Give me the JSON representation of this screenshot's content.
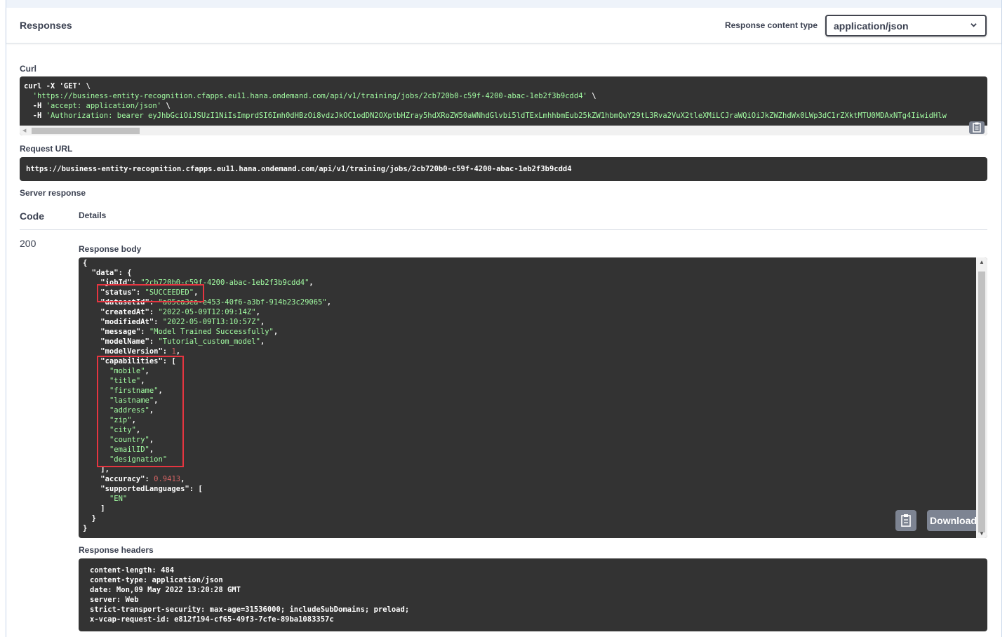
{
  "header": {
    "title": "Responses",
    "content_type_label": "Response content type",
    "content_type_value": "application/json"
  },
  "curl": {
    "label": "Curl",
    "line1": "curl -X 'GET' \\",
    "line2_url": "'https://business-entity-recognition.cfapps.eu11.hana.ondemand.com/api/v1/training/jobs/2cb720b0-c59f-4200-abac-1eb2f3b9cdd4'",
    "line2_tail": " \\",
    "line3_flag": "-H ",
    "line3_val": "'accept: application/json'",
    "line3_tail": " \\",
    "line4_flag": "-H ",
    "line4_val": "'Authorization: bearer eyJhbGciOiJSUzI1NiIsImprdSI6Imh0dHBzOi8vdzJkOC1odDN2OXptbHZray5hdXRoZW50aWNhdGlvbi5ldTExLmhhbmEub25kZW1hbmQuY29tL3Rva2VuX2tleXMiLCJraWQiOiJkZWZhdWx0LWp3dC1rZXktMTU0MDAxNTg4IiwidHlw"
  },
  "request_url": {
    "label": "Request URL",
    "value": "https://business-entity-recognition.cfapps.eu11.hana.ondemand.com/api/v1/training/jobs/2cb720b0-c59f-4200-abac-1eb2f3b9cdd4"
  },
  "server_response": {
    "label": "Server response",
    "col_code": "Code",
    "col_details": "Details",
    "code": "200",
    "body_label": "Response body",
    "download_label": "Download",
    "headers_label": "Response headers"
  },
  "body_json": {
    "jobId": "2cb720b0-c59f-4200-abac-1eb2f3b9cdd4",
    "status": "SUCCEEDED",
    "datasetId": "a05ca3ea-e453-40f6-a3bf-914b23c29065",
    "createdAt": "2022-05-09T12:09:14Z",
    "modifiedAt": "2022-05-09T13:10:57Z",
    "message": "Model Trained Successfully",
    "modelName": "Tutorial_custom_model",
    "modelVersion": "1",
    "capabilities": [
      "mobile",
      "title",
      "firstname",
      "lastname",
      "address",
      "zip",
      "city",
      "country",
      "emailID",
      "designation"
    ],
    "accuracy": "0.9413",
    "supportedLanguages": [
      "EN"
    ]
  },
  "response_headers": [
    "content-length: 484",
    "content-type: application/json",
    "date: Mon,09 May 2022 13:20:28 GMT",
    "server: Web",
    "strict-transport-security: max-age=31536000; includeSubDomains; preload;",
    "x-vcap-request-id: e812f194-cf65-49f3-7cfe-89ba1083357c"
  ],
  "colors": {
    "code_bg": "#333333",
    "string": "#a2fca2",
    "number": "#d36363",
    "highlight": "#e53540"
  }
}
